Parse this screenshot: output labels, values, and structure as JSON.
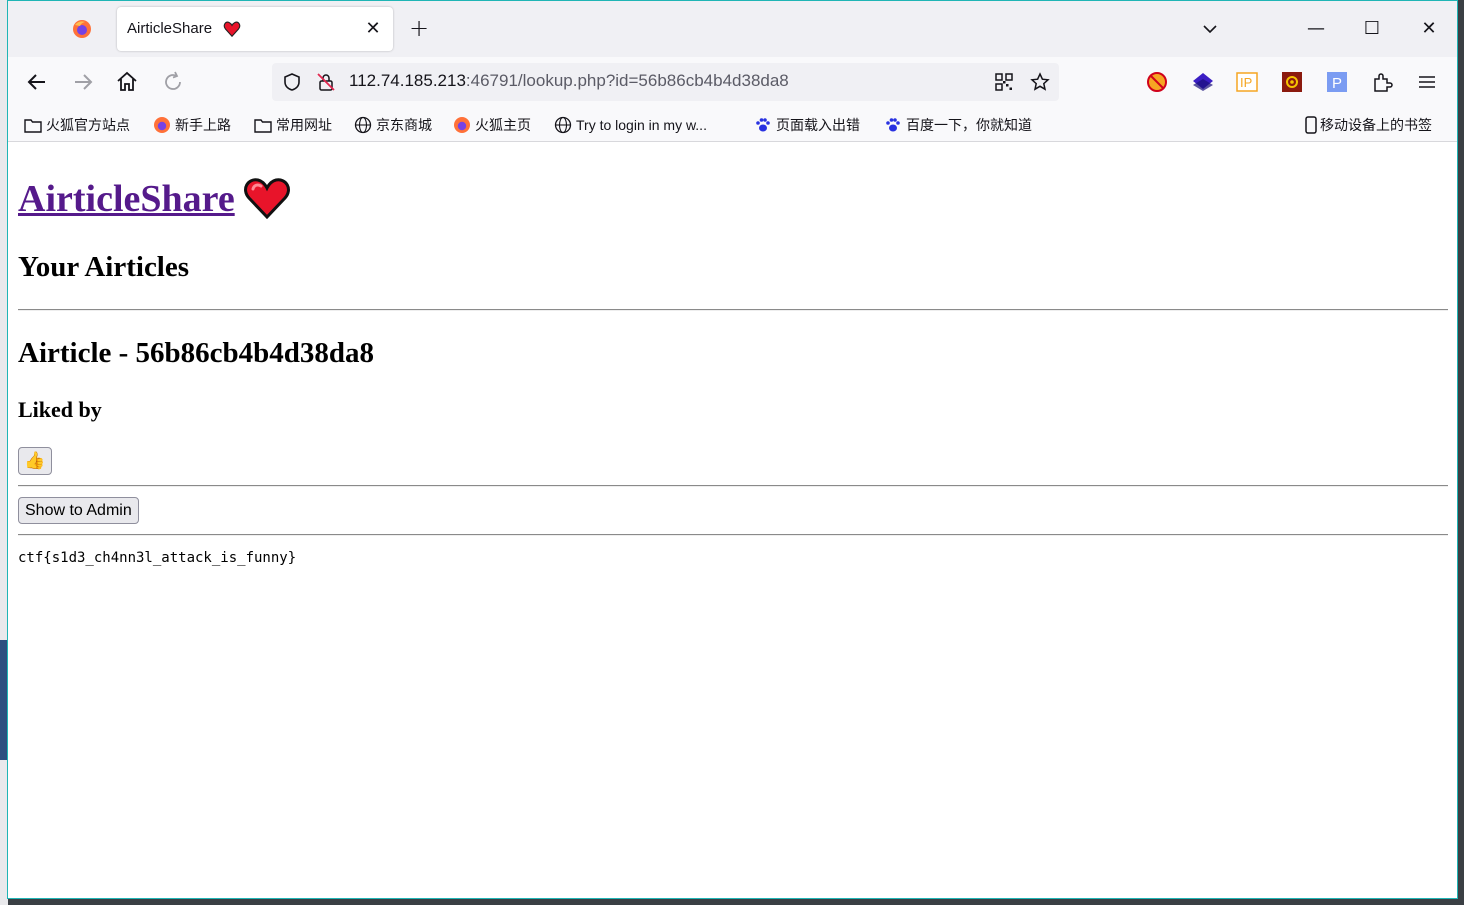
{
  "browser": {
    "tab": {
      "title": "AirticleShare",
      "close_glyph": "✕"
    },
    "new_tab_glyph": "+",
    "window_controls": {
      "minimize": "—",
      "maximize": "☐",
      "close": "✕"
    },
    "url": {
      "host": "112.74.185.213",
      "rest": ":46791/lookup.php?id=56b86cb4b4d38da8"
    },
    "bookmarks": [
      {
        "label": "火狐官方站点",
        "icon": "folder-icon"
      },
      {
        "label": "新手上路",
        "icon": "firefox-icon"
      },
      {
        "label": "常用网址",
        "icon": "folder-icon"
      },
      {
        "label": "京东商城",
        "icon": "globe-icon"
      },
      {
        "label": "火狐主页",
        "icon": "firefox-icon"
      },
      {
        "label": "Try to login in my w...",
        "icon": "globe-icon"
      },
      {
        "label": "页面载入出错",
        "icon": "baidu-icon"
      },
      {
        "label": "百度一下，你就知道",
        "icon": "baidu-icon"
      }
    ],
    "mobile_bookmarks": "移动设备上的书签"
  },
  "page": {
    "site_title": "AirticleShare",
    "section_title": "Your Airticles",
    "airticle_title": "Airticle - 56b86cb4b4d38da8",
    "liked_by": "Liked by",
    "like_button": "👍",
    "admin_button": "Show to Admin",
    "flag": "ctf{s1d3_ch4nn3l_attack_is_funny}"
  },
  "colors": {
    "link_visited": "#551a8b",
    "accent_border": "#1fb5b5"
  }
}
